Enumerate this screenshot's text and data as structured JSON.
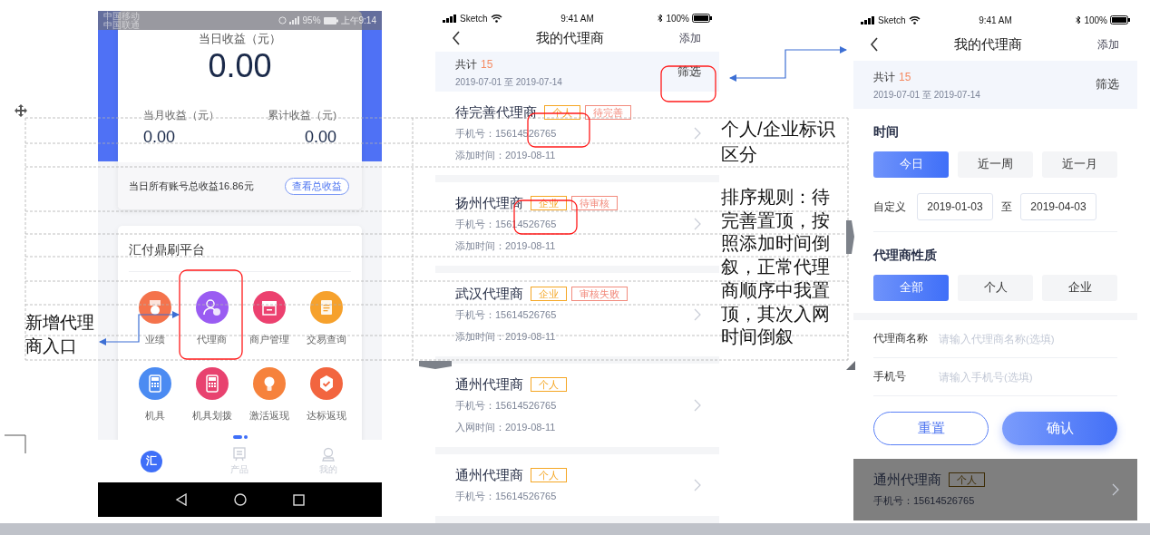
{
  "home_screen": {
    "status_bar": {
      "carriers": [
        "中国移动",
        "中国联通"
      ],
      "battery": "95%",
      "time": "上午9:14"
    },
    "earnings": {
      "today_label": "当日收益（元）",
      "today_value": "0.00",
      "month_label": "当月收益（元）",
      "month_value": "0.00",
      "total_label": "累计收益（元)",
      "total_value": "0.00"
    },
    "summary": {
      "text": "当日所有账号总收益16.86元",
      "button": "查看总收益"
    },
    "platform": {
      "title": "汇付鼎刷平台",
      "apps": [
        {
          "label": "业绩",
          "kind": "medal",
          "color": "#f4734c"
        },
        {
          "label": "代理商",
          "kind": "person",
          "color": "#9a5cf2"
        },
        {
          "label": "商户管理",
          "kind": "store",
          "color": "#ec416f"
        },
        {
          "label": "交易查询",
          "kind": "clipboard",
          "color": "#f6a12c"
        },
        {
          "label": "机具",
          "kind": "terminal",
          "color": "#4b8bf2"
        },
        {
          "label": "机具划拨",
          "kind": "terminal",
          "color": "#e8426f"
        },
        {
          "label": "激活返现",
          "kind": "bulb",
          "color": "#f6823c"
        },
        {
          "label": "达标返现",
          "kind": "check",
          "color": "#f2653f"
        }
      ]
    },
    "tabs": [
      {
        "glyph": "汇",
        "kind": "home",
        "selected": true
      },
      {
        "label": "产品",
        "kind": "document",
        "selected": false
      },
      {
        "label": "我的",
        "kind": "profile",
        "selected": false
      }
    ]
  },
  "list_screen": {
    "status_bar": {
      "carrier": "Sketch",
      "time": "9:41 AM",
      "battery": "100%"
    },
    "title": "我的代理商",
    "action": "添加",
    "summary": {
      "total_label": "共计",
      "total_count": "15",
      "date_range": "2019-07-01 至 2019-07-14",
      "filter": "筛选"
    },
    "items": [
      {
        "name": "待完善代理商",
        "tags": [
          {
            "text": "个人",
            "color": "#f5a623"
          },
          {
            "text": "待完善",
            "color": "#f28b7d"
          }
        ],
        "phone": "手机号：15614526765",
        "time": "添加时间：2019-08-11"
      },
      {
        "name": "扬州代理商",
        "tags": [
          {
            "text": "企业",
            "color": "#f5a623"
          },
          {
            "text": "待审核",
            "color": "#f28b7d"
          }
        ],
        "phone": "手机号：15614526765",
        "time": "添加时间：2019-08-11"
      },
      {
        "name": "武汉代理商",
        "tags": [
          {
            "text": "企业",
            "color": "#f5a623"
          },
          {
            "text": "审核失败",
            "color": "#f28b7d"
          }
        ],
        "phone": "手机号：15614526765",
        "time": "添加时间：2019-08-11"
      },
      {
        "name": "通州代理商",
        "tags": [
          {
            "text": "个人",
            "color": "#f5a623"
          }
        ],
        "phone": "手机号：15614526765",
        "time": "入网时间：2019-08-11"
      },
      {
        "name": "通州代理商",
        "tags": [
          {
            "text": "个人",
            "color": "#f5a623"
          }
        ],
        "phone": "手机号：15614526765"
      }
    ]
  },
  "filter_screen": {
    "status_bar": {
      "carrier": "Sketch",
      "time": "9:41 AM",
      "battery": "100%"
    },
    "title": "我的代理商",
    "action": "添加",
    "summary": {
      "total_label": "共计",
      "total_count": "15",
      "date_range": "2019-07-01 至 2019-07-14",
      "filter": "筛选"
    },
    "time_section": {
      "title": "时间",
      "options": [
        {
          "label": "今日",
          "selected": true
        },
        {
          "label": "近一周",
          "selected": false
        },
        {
          "label": "近一月",
          "selected": false
        }
      ],
      "custom_label": "自定义",
      "start": "2019-01-03",
      "separator": "至",
      "end": "2019-04-03"
    },
    "type_section": {
      "title": "代理商性质",
      "options": [
        {
          "label": "全部",
          "selected": true
        },
        {
          "label": "个人",
          "selected": false
        },
        {
          "label": "企业",
          "selected": false
        }
      ]
    },
    "fields": [
      {
        "label": "代理商名称",
        "placeholder": "请输入代理商名称(选填)"
      },
      {
        "label": "手机号",
        "placeholder": "请输入手机号(选填)"
      }
    ],
    "buttons": [
      {
        "label": "重置",
        "kind": "outline"
      },
      {
        "label": "确认",
        "kind": "primary"
      }
    ],
    "background_item": {
      "name": "通州代理商",
      "tags": [
        {
          "text": "个人",
          "color": "#3d2c06"
        }
      ],
      "phone": "手机号：15614526765"
    }
  },
  "annotations": [
    {
      "text": "新增代理商入口"
    },
    {
      "text": "个人/企业标识区分"
    },
    {
      "text": "排序规则：待完善置顶，按照添加时间倒叙，正常代理商顺序中我置顶，其次入网时间倒叙"
    }
  ]
}
